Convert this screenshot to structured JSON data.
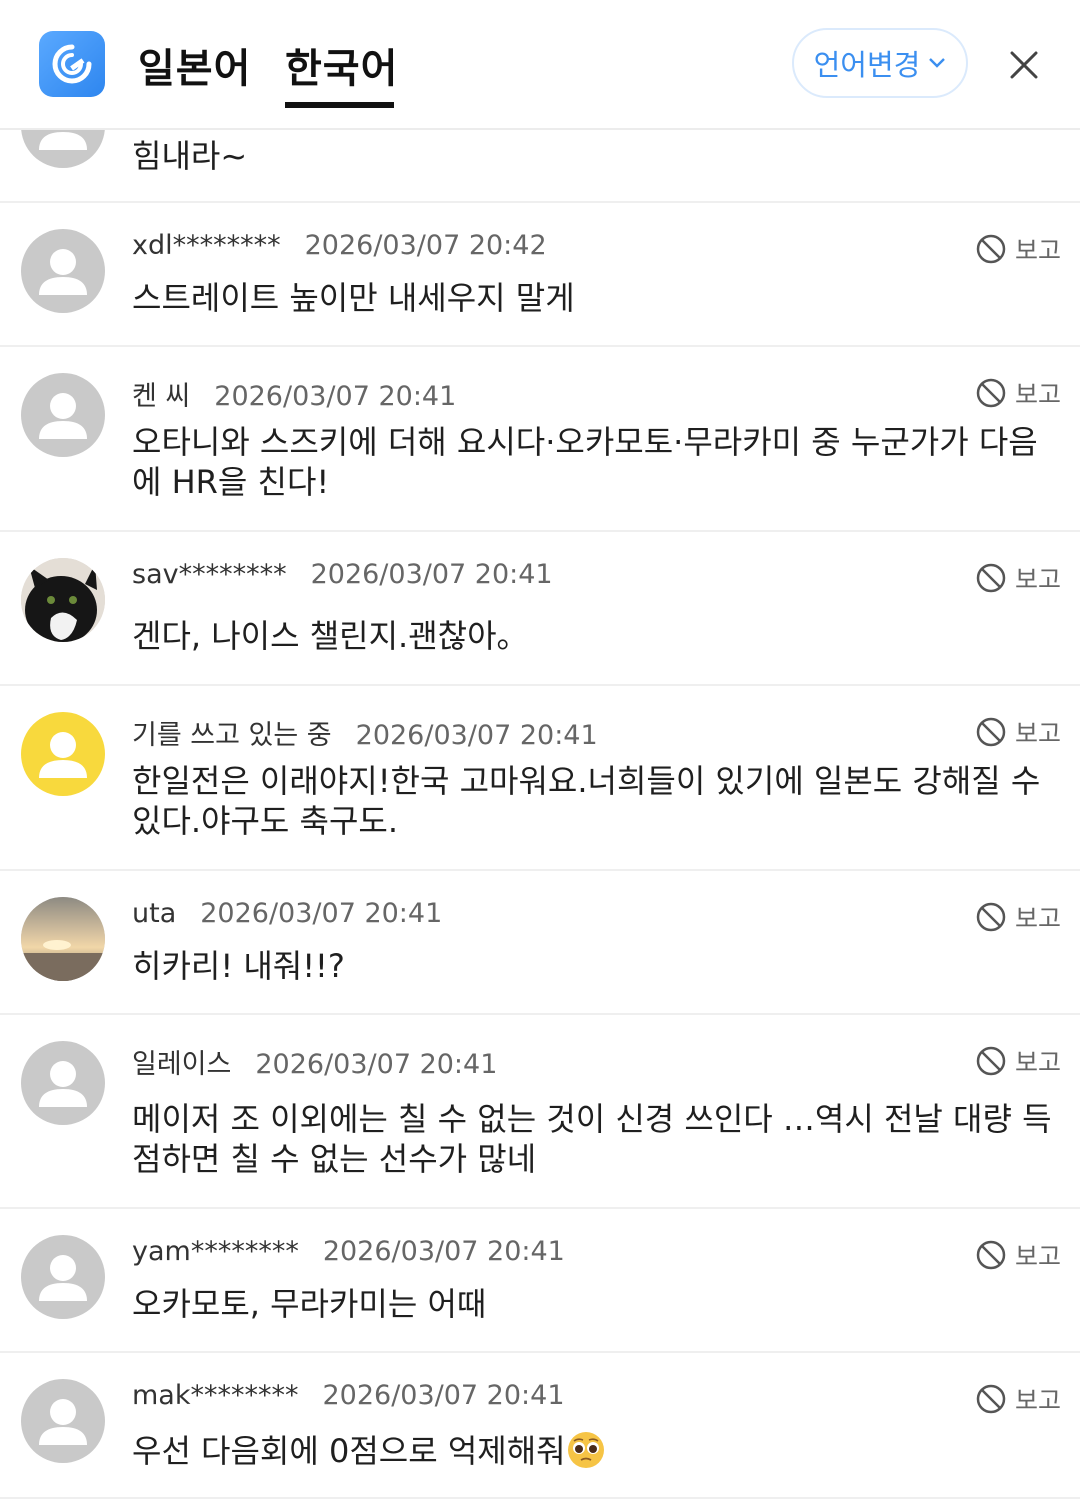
{
  "header": {
    "tabs": [
      {
        "label": "일본어",
        "active": false
      },
      {
        "label": "한국어",
        "active": true
      }
    ],
    "language_button": "언어변경",
    "logo_icon": "app-logo-icon",
    "close_icon": "close-icon"
  },
  "report_label": "보고",
  "colors": {
    "accent": "#3b8ff0",
    "default_avatar": "#c9c9c9",
    "yellow_avatar": "#f8d93d"
  },
  "partial_comment": {
    "text": "힘내라~"
  },
  "comments": [
    {
      "user": "xdl********",
      "date": "2026/03/07 20:42",
      "text": "스트레이트 높이만 내세우지 말게",
      "avatar": "default"
    },
    {
      "user": "켄 씨",
      "date": "2026/03/07 20:41",
      "text": "오타니와 스즈키에 더해 요시다·오카모토·무라카미 중 누군가가 다음에 HR을 친다!",
      "avatar": "default"
    },
    {
      "user": "sav********",
      "date": "2026/03/07 20:41",
      "text": "겐다, 나이스 챌린지.괜찮아。",
      "avatar": "cat-photo"
    },
    {
      "user": "기를 쓰고 있는 중",
      "date": "2026/03/07 20:41",
      "text": "한일전은 이래야지!한국 고마워요.너희들이 있기에 일본도 강해질 수 있다.야구도 축구도.",
      "avatar": "yellow"
    },
    {
      "user": "uta",
      "date": "2026/03/07 20:41",
      "text": "히카리! 내줘!!?",
      "avatar": "sunset-photo"
    },
    {
      "user": "일레이스",
      "date": "2026/03/07 20:41",
      "text": "메이저 조 이외에는 칠 수 없는 것이 신경 쓰인다 …역시 전날 대량 득점하면 칠 수 없는 선수가 많네",
      "avatar": "default"
    },
    {
      "user": "yam********",
      "date": "2026/03/07 20:41",
      "text": "오카모토, 무라카미는 어때",
      "avatar": "default"
    },
    {
      "user": "mak********",
      "date": "2026/03/07 20:41",
      "text": "우선 다음회에 0점으로 억제해줘",
      "avatar": "default",
      "trailing_emoji": "pleading-face-emoji"
    }
  ]
}
